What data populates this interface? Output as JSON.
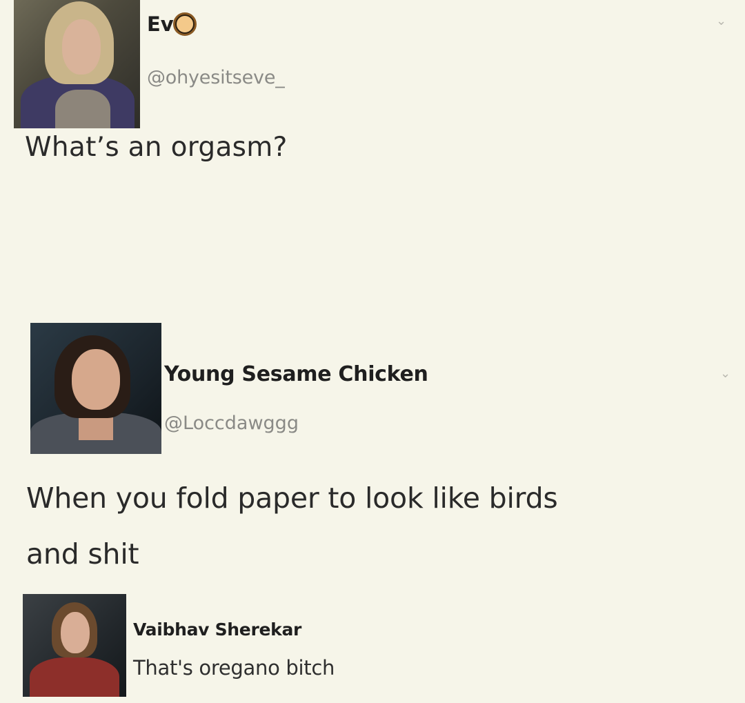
{
  "tweet": {
    "display_name": "Ev",
    "display_name_emoji": "lion-face-icon",
    "handle": "@ohyesitseve_",
    "text": "What’s an orgasm?"
  },
  "reply": {
    "display_name": "Young Sesame Chicken",
    "handle": "@Loccdawggg",
    "text_line_1": "When you fold paper to look like birds",
    "text_line_2": "and shit"
  },
  "comment": {
    "display_name": "Vaibhav Sherekar",
    "text": "That's oregano bitch"
  },
  "icons": {
    "more_options": "chevron-down-icon"
  },
  "colors": {
    "background": "#f6f5e9",
    "text_primary": "#2a2a2a",
    "text_secondary": "#8a8a86"
  }
}
